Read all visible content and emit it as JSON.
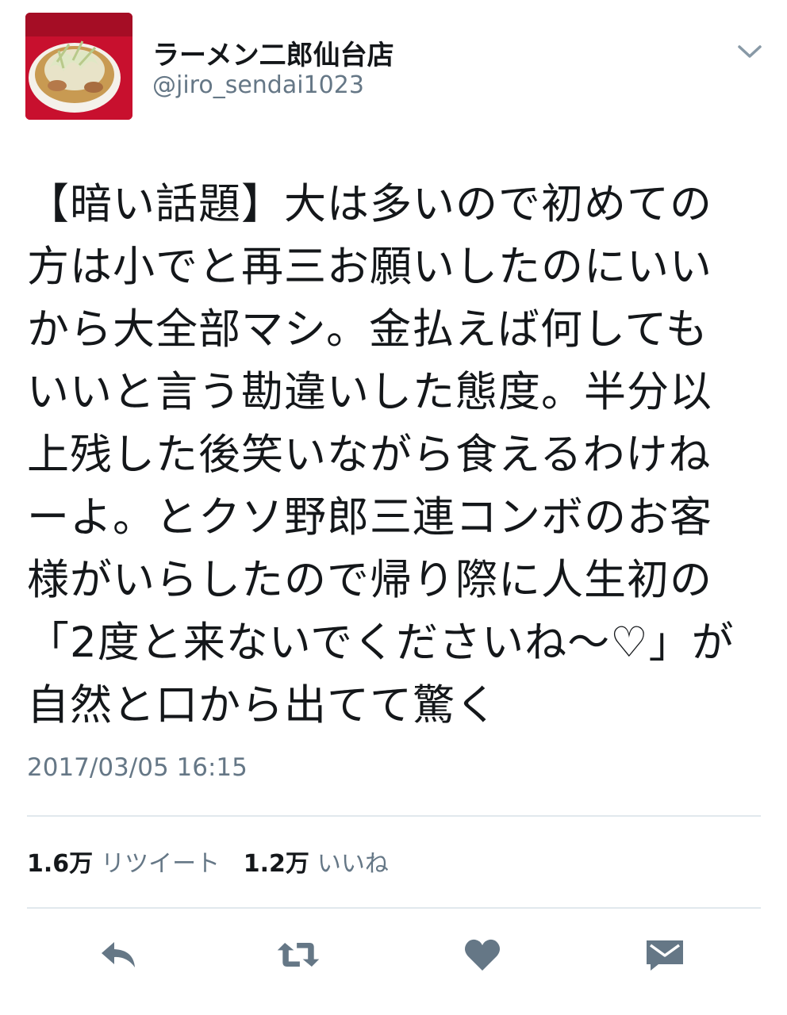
{
  "user": {
    "display_name": "ラーメン二郎仙台店",
    "handle": "@jiro_sendai1023",
    "avatar_icon": "ramen-bowl-avatar"
  },
  "tweet": {
    "lines": [
      "【暗い話題】大は多いので初めての",
      "方は小でと再三お願いしたのにいい",
      "から大全部マシ。金払えば何しても",
      "いいと言う勘違いした態度。半分以",
      "上残した後笑いながら食えるわけね",
      "ーよ。とクソ野郎三連コンボのお客",
      "様がいらしたので帰り際に人生初の",
      "「2度と来ないでくださいね〜♡」が",
      "自然と口から出てて驚く"
    ],
    "timestamp": "2017/03/05 16:15"
  },
  "stats": {
    "retweets_count": "1.6万",
    "retweets_label": "リツイート",
    "likes_count": "1.2万",
    "likes_label": "いいね"
  },
  "actions": {
    "icons": [
      "reply-icon",
      "retweet-icon",
      "heart-icon",
      "direct-message-icon"
    ],
    "color": "#657786"
  },
  "colors": {
    "text": "#14171a",
    "secondary": "#657786",
    "divider": "#e1e8ed",
    "avatar_bg": "#c8102e"
  }
}
